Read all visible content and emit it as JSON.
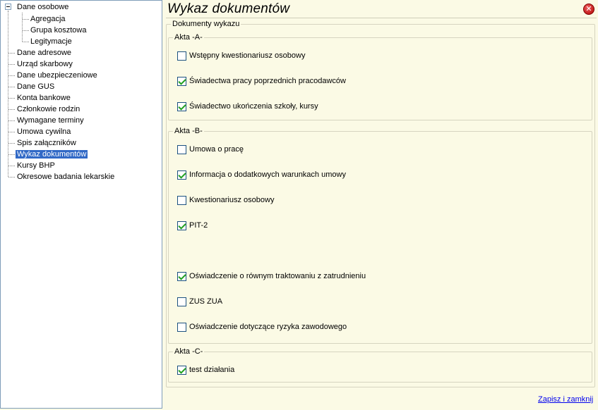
{
  "tree": {
    "root": {
      "label": "Dane osobowe"
    },
    "children": [
      {
        "label": "Agregacja"
      },
      {
        "label": "Grupa kosztowa"
      },
      {
        "label": "Legitymacje"
      }
    ],
    "items": [
      {
        "label": "Dane adresowe"
      },
      {
        "label": "Urząd skarbowy"
      },
      {
        "label": "Dane ubezpieczeniowe"
      },
      {
        "label": "Dane GUS"
      },
      {
        "label": "Konta bankowe"
      },
      {
        "label": "Członkowie rodzin"
      },
      {
        "label": "Wymagane terminy"
      },
      {
        "label": "Umowa cywilna"
      },
      {
        "label": "Spis załączników"
      },
      {
        "label": "Wykaz dokumentów",
        "selected": true
      },
      {
        "label": "Kursy BHP"
      },
      {
        "label": "Okresowe badania lekarskie"
      }
    ]
  },
  "header": {
    "title": "Wykaz dokumentów",
    "close_icon": "close-icon"
  },
  "main": {
    "section_title": "Dokumenty wykazu",
    "groups": [
      {
        "title": "Akta -A-",
        "items": [
          {
            "label": "Wstępny kwestionariusz osobowy",
            "checked": false
          },
          {
            "label": "Świadectwa pracy poprzednich pracodawców",
            "checked": true
          },
          {
            "label": "Świadectwo ukończenia szkoły, kursy",
            "checked": true
          }
        ]
      },
      {
        "title": "Akta -B-",
        "items": [
          {
            "label": "Umowa o pracę",
            "checked": false
          },
          {
            "label": "Informacja o dodatkowych warunkach umowy",
            "checked": true
          },
          {
            "label": "Kwestionariusz osobowy",
            "checked": false
          },
          {
            "label": "PIT-2",
            "checked": true
          },
          {
            "label": "Oświadczenie o równym traktowaniu z zatrudnieniu",
            "checked": true
          },
          {
            "label": "ZUS ZUA",
            "checked": false
          },
          {
            "label": "Oświadczenie dotyczące ryzyka zawodowego",
            "checked": false
          }
        ]
      },
      {
        "title": "Akta -C-",
        "items": [
          {
            "label": "test działania",
            "checked": true
          }
        ]
      }
    ]
  },
  "footer": {
    "save_link": "Zapisz i zamknij"
  }
}
